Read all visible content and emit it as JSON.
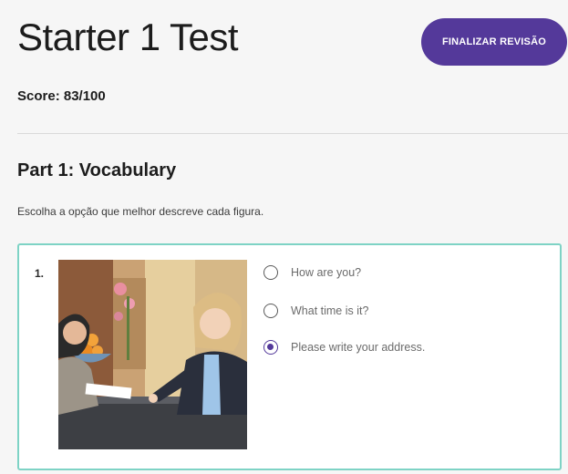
{
  "header": {
    "title": "Starter 1 Test",
    "finish_button_label": "FINALIZAR REVISÃO",
    "score_text": "Score: 83/100"
  },
  "part": {
    "title": "Part 1: Vocabulary",
    "instructions": "Escolha a opção que melhor descreve cada figura."
  },
  "question": {
    "number": "1.",
    "image_icon": "photo-receptionist-icon",
    "options": [
      {
        "label": "How are you?",
        "selected": false
      },
      {
        "label": "What time is it?",
        "selected": false
      },
      {
        "label": "Please write your address.",
        "selected": true
      }
    ]
  },
  "colors": {
    "accent": "#54399a",
    "card_border": "#7ed3c5"
  }
}
